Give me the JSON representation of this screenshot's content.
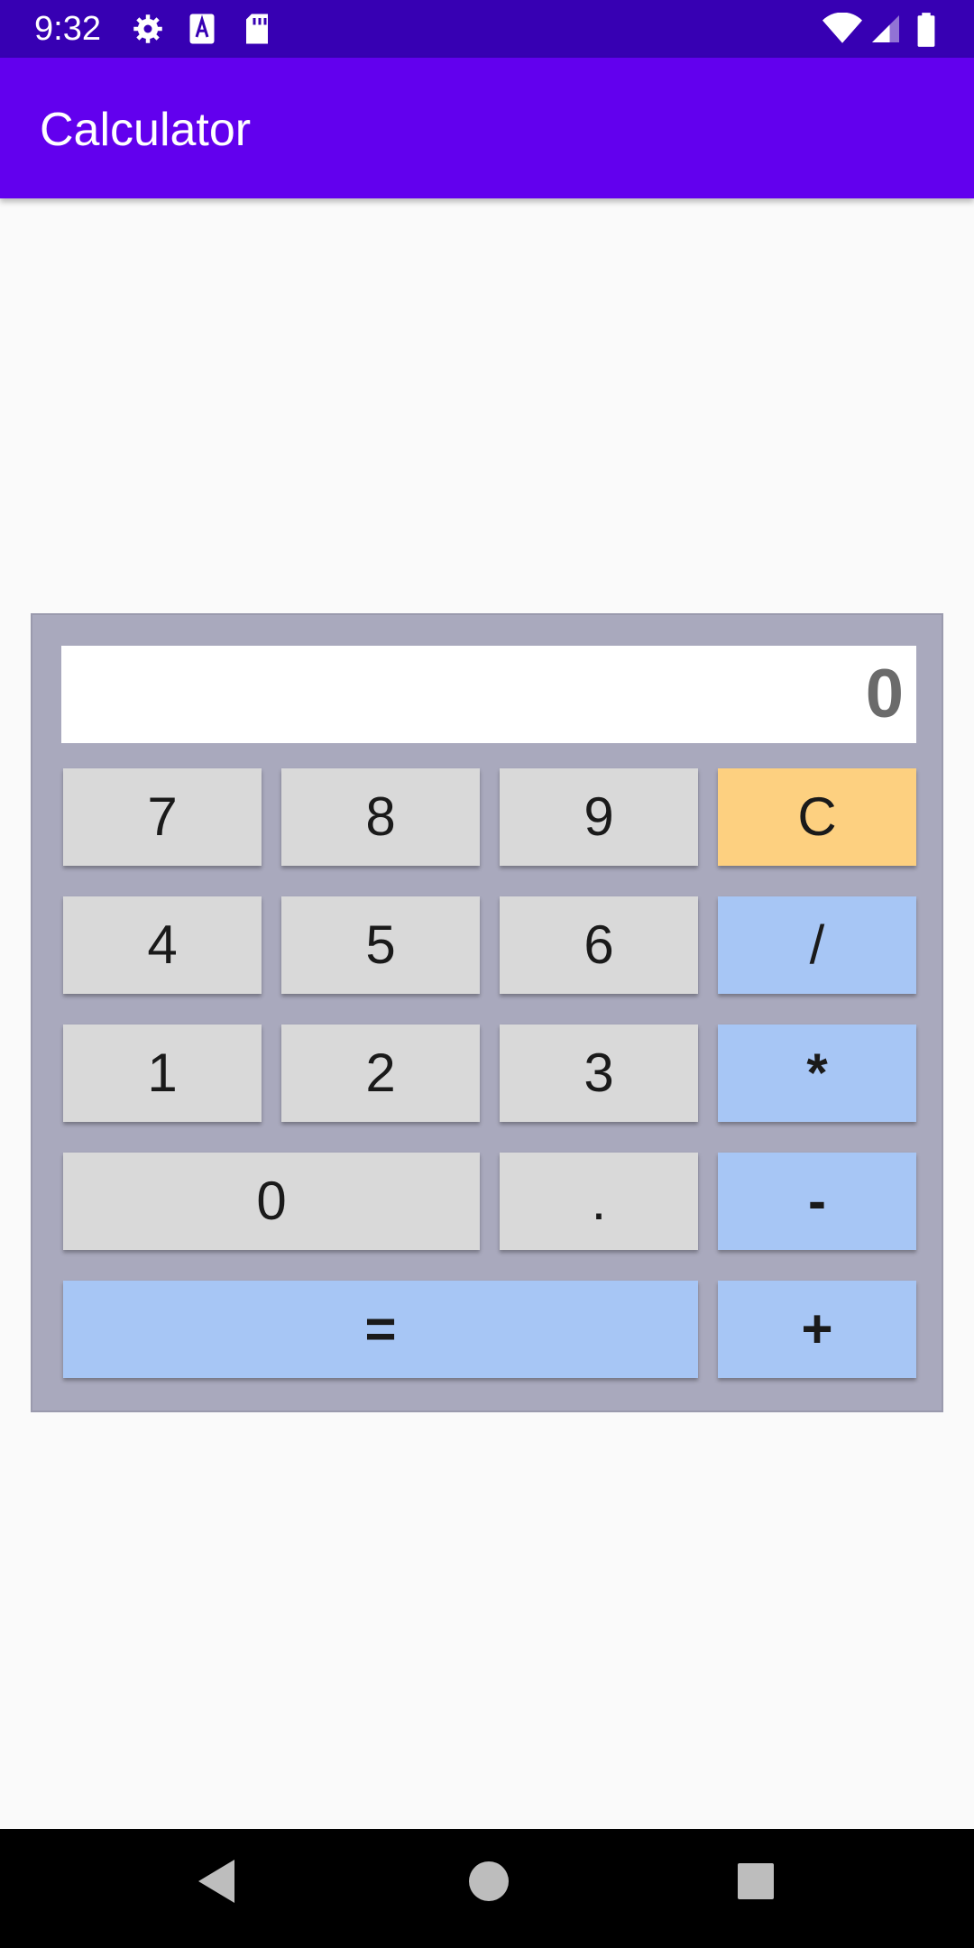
{
  "status_bar": {
    "time": "9:32",
    "left_icons": [
      "gear-icon",
      "font-a-icon",
      "sd-card-icon"
    ],
    "right_icons": [
      "wifi-icon",
      "cell-signal-icon",
      "battery-icon"
    ]
  },
  "app_bar": {
    "title": "Calculator",
    "color": "#6200ee",
    "status_color": "#3700b3"
  },
  "calculator": {
    "display_value": "0",
    "panel_color": "#a9a9bd",
    "number_key_color": "#d9d9d9",
    "operator_key_color": "#a7c6f5",
    "clear_key_color": "#fdd080",
    "keys": {
      "seven": "7",
      "eight": "8",
      "nine": "9",
      "clear": "C",
      "four": "4",
      "five": "5",
      "six": "6",
      "divide": "/",
      "one": "1",
      "two": "2",
      "three": "3",
      "multiply": "*",
      "zero": "0",
      "decimal": ".",
      "subtract": "-",
      "equals": "=",
      "add": "+"
    }
  },
  "nav_bar": {
    "buttons": [
      "back-icon",
      "home-icon",
      "recents-icon"
    ]
  }
}
